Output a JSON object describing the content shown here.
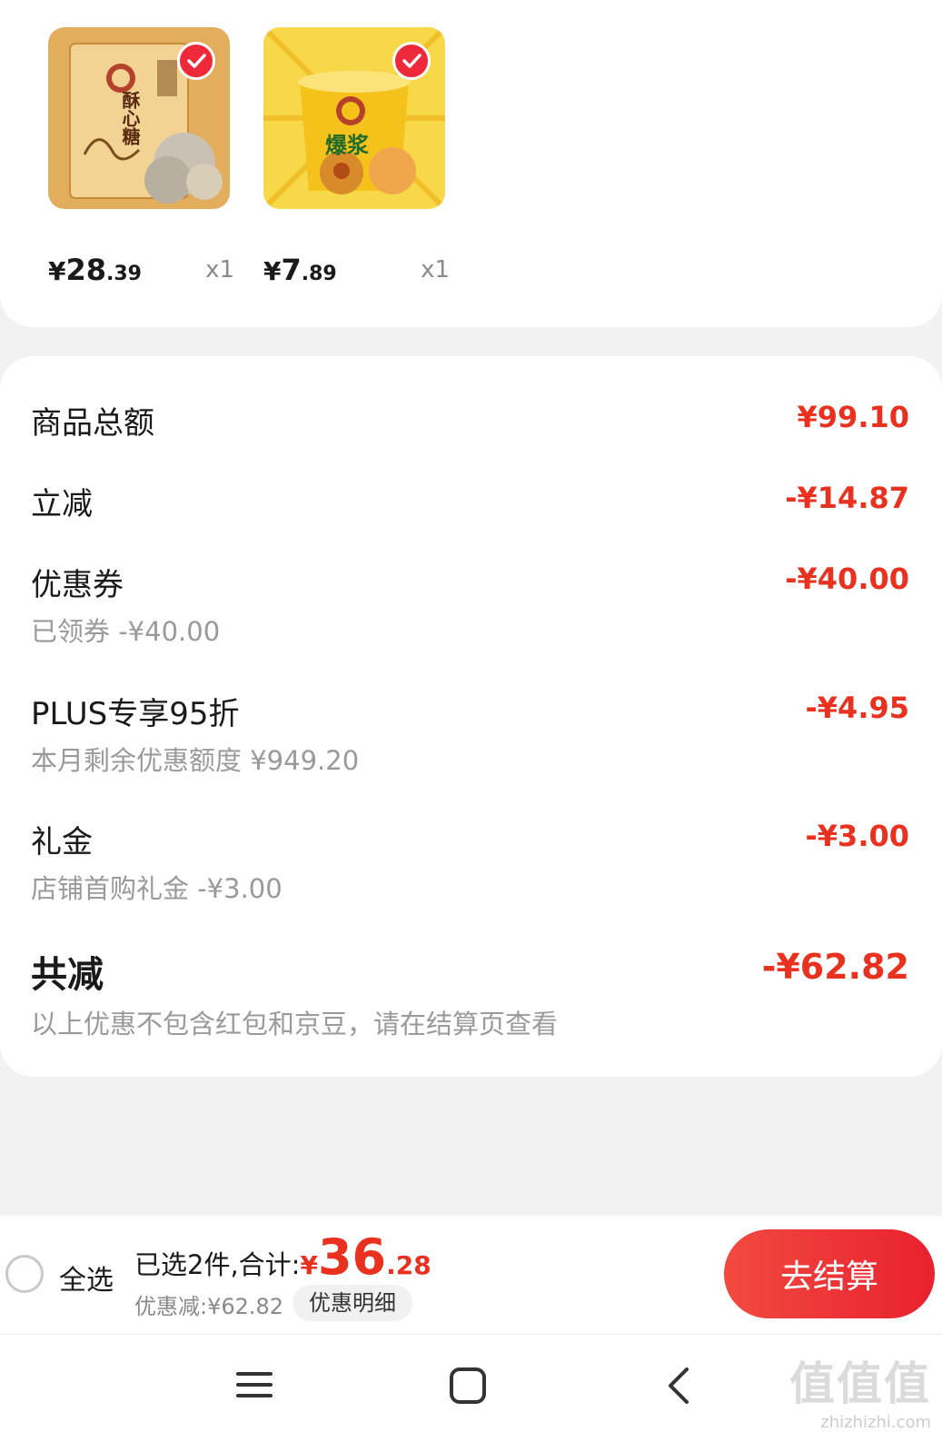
{
  "products": [
    {
      "package_text": "酥心糖",
      "price_currency": "¥",
      "price_int": "28",
      "price_dec": ".39",
      "qty": "x1",
      "checked": true
    },
    {
      "package_text": "爆浆",
      "price_currency": "¥",
      "price_int": "7",
      "price_dec": ".89",
      "qty": "x1",
      "checked": true
    }
  ],
  "summary": {
    "goods_total": {
      "label": "商品总额",
      "value": "¥99.10"
    },
    "instant_discount": {
      "label": "立减",
      "value": "-¥14.87"
    },
    "coupon": {
      "label": "优惠券",
      "value": "-¥40.00",
      "sub": "已领券 -¥40.00"
    },
    "plus": {
      "label": "PLUS专享95折",
      "value": "-¥4.95",
      "sub": "本月剩余优惠额度 ¥949.20"
    },
    "gift": {
      "label": "礼金",
      "value": "-¥3.00",
      "sub": "店铺首购礼金 -¥3.00"
    },
    "total_discount": {
      "label": "共减",
      "value": "-¥62.82",
      "sub": "以上优惠不包含红包和京豆，请在结算页查看"
    }
  },
  "action_bar": {
    "select_all": "全选",
    "selected_prefix": "已选2件,合计:",
    "total_currency": "¥",
    "total_int": "36",
    "total_dec": ".28",
    "discount_text": "优惠减:¥62.82",
    "detail_button": "优惠明细",
    "checkout_button": "去结算"
  },
  "watermark": {
    "logo": "值值值",
    "url": "zhizhizhi.com"
  },
  "colors": {
    "accent_red": "#e8311f",
    "check_red": "#ee2a3a",
    "background": "#f2f2f2"
  }
}
